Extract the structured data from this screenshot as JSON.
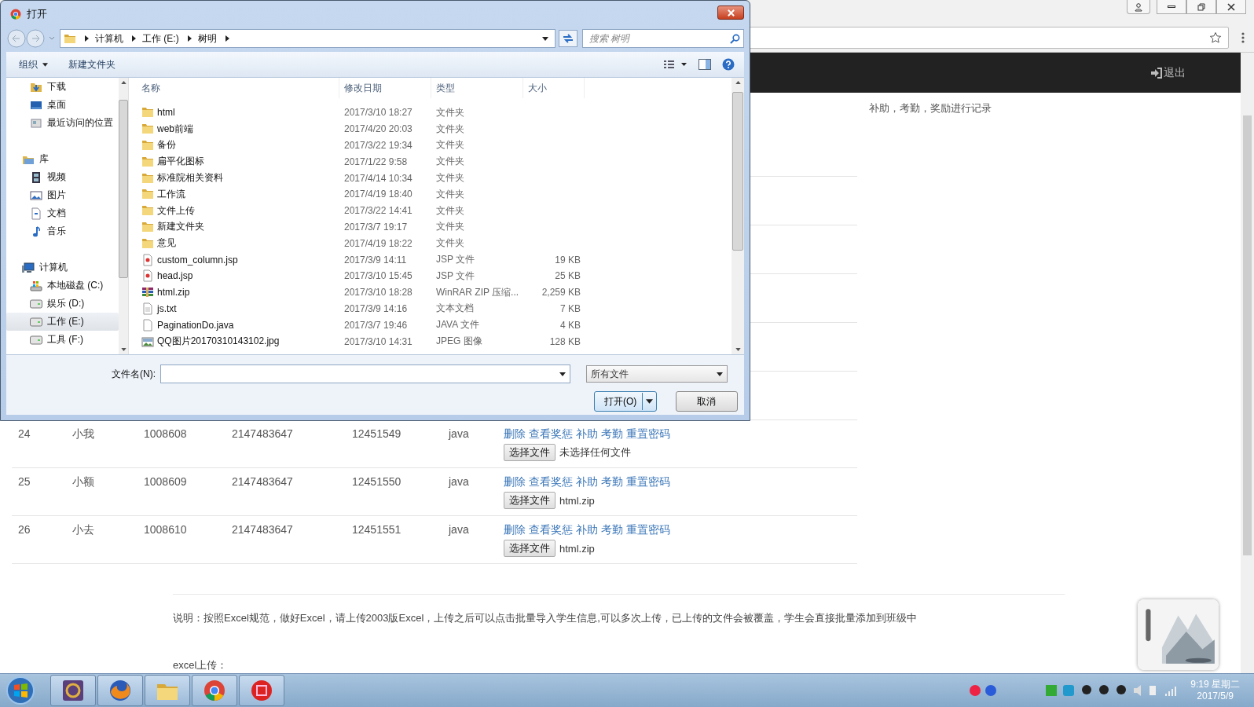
{
  "browser": {
    "logout": "退出",
    "side_note": "补助，考勤，奖励进行记录"
  },
  "table": {
    "rows": [
      {
        "cells": [
          "24",
          "小我",
          "1008608",
          "2147483647",
          "12451549",
          "java"
        ],
        "actions": [
          "删除",
          "查看奖惩",
          "补助",
          "考勤",
          "重置密码"
        ],
        "file_button": "选择文件",
        "file_status": "未选择任何文件"
      },
      {
        "cells": [
          "25",
          "小额",
          "1008609",
          "2147483647",
          "12451550",
          "java"
        ],
        "actions": [
          "删除",
          "查看奖惩",
          "补助",
          "考勤",
          "重置密码"
        ],
        "file_button": "选择文件",
        "file_status": "html.zip"
      },
      {
        "cells": [
          "26",
          "小去",
          "1008610",
          "2147483647",
          "12451551",
          "java"
        ],
        "actions": [
          "删除",
          "查看奖惩",
          "补助",
          "考勤",
          "重置密码"
        ],
        "file_button": "选择文件",
        "file_status": "html.zip"
      }
    ]
  },
  "description": "说明：按照Excel规范，做好Excel，请上传2003版Excel，上传之后可以点击批量导入学生信息,可以多次上传，已上传的文件会被覆盖，学生会直接批量添加到班级中",
  "upload_label": "excel上传：",
  "dialog": {
    "title": "打开",
    "breadcrumb": [
      "计算机",
      "工作 (E:)",
      "树明"
    ],
    "search": {
      "placeholder": "搜索 树明"
    },
    "toolbar": [
      "组织",
      "新建文件夹"
    ],
    "nav": [
      {
        "children": [
          {
            "label": "下载",
            "kind": "download",
            "selected": false
          },
          {
            "label": "桌面",
            "kind": "desktop",
            "selected": false
          },
          {
            "label": "最近访问的位置",
            "kind": "recent",
            "selected": false
          }
        ]
      },
      {
        "label": "库",
        "kind": "library",
        "selected": false,
        "children": [
          {
            "label": "视频",
            "kind": "video",
            "selected": false
          },
          {
            "label": "图片",
            "kind": "picture",
            "selected": false
          },
          {
            "label": "文档",
            "kind": "document",
            "selected": false
          },
          {
            "label": "音乐",
            "kind": "music",
            "selected": false
          }
        ]
      },
      {
        "label": "计算机",
        "kind": "computer",
        "selected": false,
        "children": [
          {
            "label": "本地磁盘 (C:)",
            "kind": "system-disk",
            "selected": false
          },
          {
            "label": "娱乐 (D:)",
            "kind": "disk",
            "selected": false
          },
          {
            "label": "工作 (E:)",
            "kind": "disk",
            "selected": true
          },
          {
            "label": "工具 (F:)",
            "kind": "disk",
            "selected": false
          }
        ]
      }
    ],
    "columns": [
      "名称",
      "修改日期",
      "类型",
      "大小"
    ],
    "files": [
      {
        "name": "html",
        "date": "2017/3/10 18:27",
        "type": "文件夹",
        "kind": "folder"
      },
      {
        "name": "web前端",
        "date": "2017/4/20 20:03",
        "type": "文件夹",
        "kind": "folder"
      },
      {
        "name": "备份",
        "date": "2017/3/22 19:34",
        "type": "文件夹",
        "kind": "folder"
      },
      {
        "name": "扁平化图标",
        "date": "2017/1/22 9:58",
        "type": "文件夹",
        "kind": "folder"
      },
      {
        "name": "标准院相关资料",
        "date": "2017/4/14 10:34",
        "type": "文件夹",
        "kind": "folder"
      },
      {
        "name": "工作流",
        "date": "2017/4/19 18:40",
        "type": "文件夹",
        "kind": "folder"
      },
      {
        "name": "文件上传",
        "date": "2017/3/22 14:41",
        "type": "文件夹",
        "kind": "folder"
      },
      {
        "name": "新建文件夹",
        "date": "2017/3/7 19:17",
        "type": "文件夹",
        "kind": "folder"
      },
      {
        "name": "意见",
        "date": "2017/4/19 18:22",
        "type": "文件夹",
        "kind": "folder"
      },
      {
        "name": "custom_column.jsp",
        "date": "2017/3/9 14:11",
        "type": "JSP 文件",
        "size": "19 KB",
        "kind": "jsp"
      },
      {
        "name": "head.jsp",
        "date": "2017/3/10 15:45",
        "type": "JSP 文件",
        "size": "25 KB",
        "kind": "jsp"
      },
      {
        "name": "html.zip",
        "date": "2017/3/10 18:28",
        "type": "WinRAR ZIP 压缩...",
        "size": "2,259 KB",
        "kind": "zip"
      },
      {
        "name": "js.txt",
        "date": "2017/3/9 14:16",
        "type": "文本文档",
        "size": "7 KB",
        "kind": "txt"
      },
      {
        "name": "PaginationDo.java",
        "date": "2017/3/7 19:46",
        "type": "JAVA 文件",
        "size": "4 KB",
        "kind": "java"
      },
      {
        "name": "QQ图片20170310143102.jpg",
        "date": "2017/3/10 14:31",
        "type": "JPEG 图像",
        "size": "128 KB",
        "kind": "jpg"
      }
    ],
    "filename": {
      "label": "文件名(N):"
    },
    "file_type": "所有文件",
    "open_button": "打开(O)",
    "cancel_button": "取消"
  },
  "taskbar": {
    "apps": [
      {
        "kind": "ide"
      },
      {
        "kind": "firefox"
      },
      {
        "kind": "explorer"
      },
      {
        "kind": "chrome"
      },
      {
        "kind": "seal"
      }
    ],
    "time": "9:19 星期二",
    "date": "2017/5/9"
  }
}
